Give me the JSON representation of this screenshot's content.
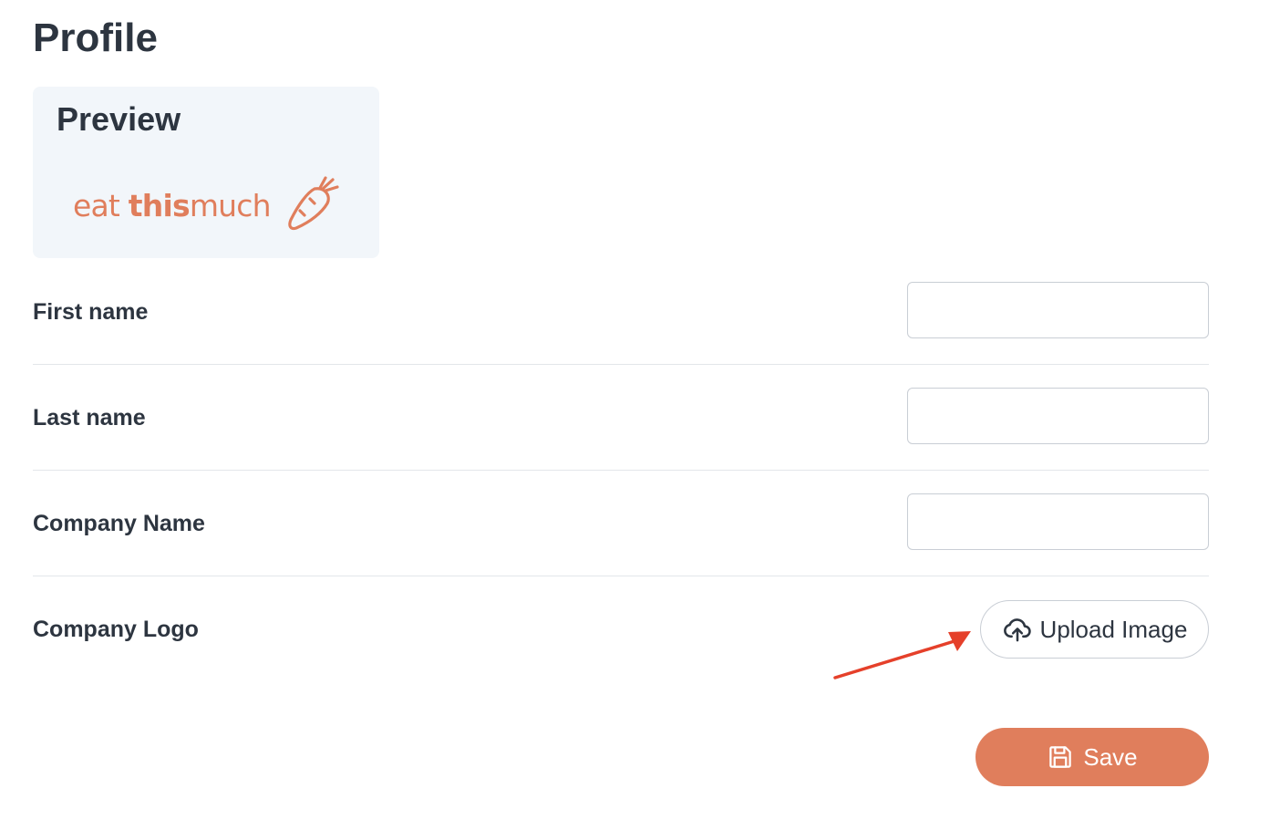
{
  "page": {
    "title": "Profile"
  },
  "preview": {
    "heading": "Preview",
    "logo": {
      "text_part1": "eat",
      "text_part2": "this",
      "text_part3": "much",
      "icon": "carrot-icon",
      "color": "#e07e5c"
    }
  },
  "form": {
    "first_name": {
      "label": "First name",
      "value": "",
      "placeholder": ""
    },
    "last_name": {
      "label": "Last name",
      "value": "",
      "placeholder": ""
    },
    "company_name": {
      "label": "Company Name",
      "value": "",
      "placeholder": ""
    },
    "company_logo": {
      "label": "Company Logo",
      "upload_label": "Upload Image",
      "upload_icon": "cloud-upload-icon"
    }
  },
  "actions": {
    "save_label": "Save",
    "save_icon": "floppy-disk-icon",
    "save_color": "#e07e5c"
  },
  "annotation": {
    "arrow_color": "#e5402a",
    "target": "upload-image-button"
  }
}
